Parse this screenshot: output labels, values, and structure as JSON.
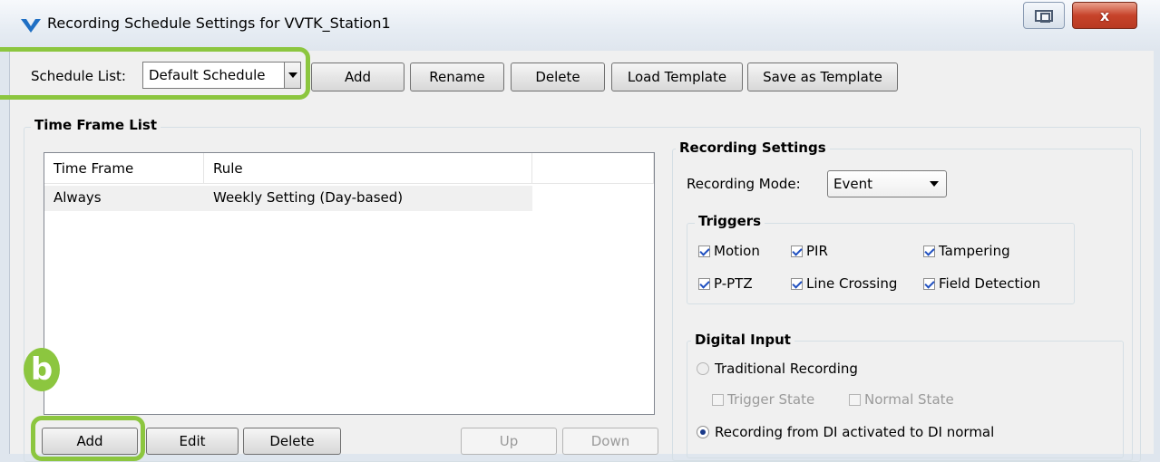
{
  "window": {
    "title": "Recording Schedule Settings for VVTK_Station1",
    "close_glyph": "x"
  },
  "toolbar": {
    "schedule_list_label": "Schedule List:",
    "schedule_value": "Default Schedule",
    "add": "Add",
    "rename": "Rename",
    "delete": "Delete",
    "load_template": "Load Template",
    "save_as_template": "Save as Template"
  },
  "time_frame_list": {
    "title": "Time Frame List",
    "columns": [
      "Time Frame",
      "Rule"
    ],
    "rows": [
      {
        "time_frame": "Always",
        "rule": "Weekly Setting (Day-based)"
      }
    ],
    "buttons": {
      "add": "Add",
      "edit": "Edit",
      "delete": "Delete",
      "up": "Up",
      "down": "Down"
    }
  },
  "recording_settings": {
    "title": "Recording Settings",
    "mode_label": "Recording Mode:",
    "mode_value": "Event",
    "triggers": {
      "title": "Triggers",
      "items": [
        {
          "label": "Motion",
          "checked": true
        },
        {
          "label": "PIR",
          "checked": true
        },
        {
          "label": "Tampering",
          "checked": true
        },
        {
          "label": "P-PTZ",
          "checked": true
        },
        {
          "label": "Line Crossing",
          "checked": true
        },
        {
          "label": "Field Detection",
          "checked": true
        }
      ]
    },
    "digital_input": {
      "title": "Digital Input",
      "traditional": "Traditional Recording",
      "trigger_state": "Trigger State",
      "normal_state": "Normal State",
      "di_activated": "Recording from DI activated to DI normal"
    }
  },
  "annotations": {
    "badge_b": "b"
  },
  "colors": {
    "highlight": "#8cc63f",
    "close_button": "#c7432a"
  },
  "icons": {
    "app_logo": "vivotek-logo-icon",
    "restore": "restore-icon",
    "dropdown": "chevron-down-icon"
  }
}
